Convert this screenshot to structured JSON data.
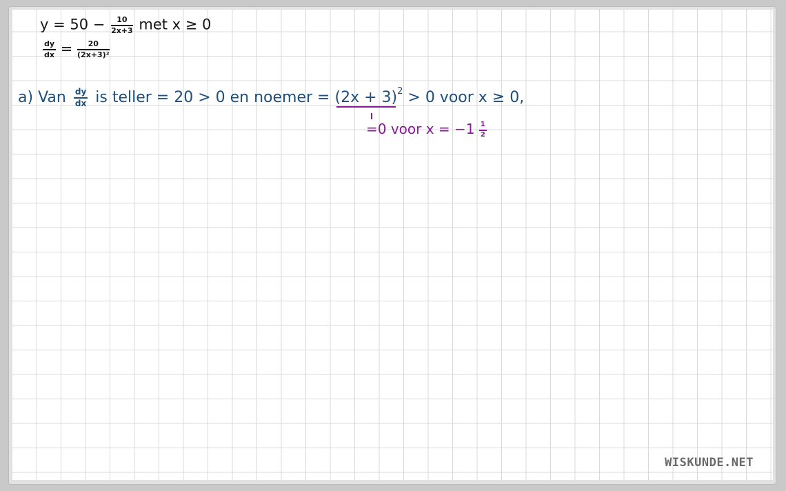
{
  "line1": {
    "lhs": "y = 50 −",
    "frac_num": "10",
    "frac_den": "2x+3",
    "rest": "met  x ≥ 0"
  },
  "line2": {
    "lhs_num": "dy",
    "lhs_den": "dx",
    "eq": "=",
    "frac_num": "20",
    "frac_den": "(2x+3)²"
  },
  "line3": {
    "prefix": "a)",
    "van": "Van",
    "frac_num": "dy",
    "frac_den": "dx",
    "middle": "is teller = 20 > 0   en  noemer =",
    "underlined": "(2x + 3)",
    "exponent": "2",
    "suffix": "> 0  voor  x ≥ 0,"
  },
  "line4": {
    "text": "=0 voor  x = −1",
    "frac_num": "1",
    "frac_den": "2"
  },
  "watermark": "WISKUNDE.NET",
  "colors": {
    "black_ink": "#161616",
    "blue_ink": "#1f4f7c",
    "purple_ink": "#8a1a9a",
    "grid": "#d9d9d9"
  }
}
